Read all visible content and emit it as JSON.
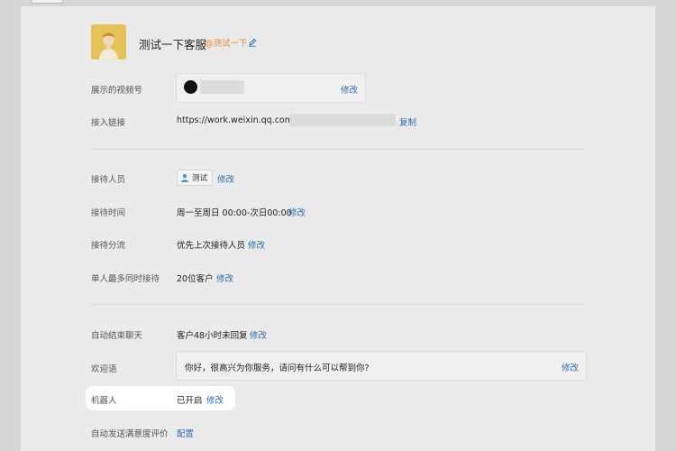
{
  "profile": {
    "name": "测试一下客服",
    "handle": "@测试一下"
  },
  "rows": {
    "channel": {
      "label": "展示的视频号",
      "edit": "修改"
    },
    "link": {
      "label": "接入链接",
      "url": "https://work.weixin.qq.com/",
      "copy": "复制"
    },
    "agents": {
      "label": "接待人员",
      "agent": "测试",
      "edit": "修改"
    },
    "hours": {
      "label": "接待时间",
      "value": "周一至周日 00:00-次日00:00",
      "edit": "修改"
    },
    "routing": {
      "label": "接待分流",
      "value": "优先上次接待人员",
      "edit": "修改"
    },
    "max_sessions": {
      "label": "单人最多同时接待",
      "value": "20位客户",
      "edit": "修改"
    },
    "auto_end": {
      "label": "自动结束聊天",
      "value": "客户48小时未回复",
      "edit": "修改"
    },
    "welcome": {
      "label": "欢迎语",
      "value": "你好，很高兴为你服务，请问有什么可以帮到你?",
      "edit": "修改"
    },
    "robot": {
      "label": "机器人",
      "value": "已开启",
      "edit": "修改"
    },
    "survey": {
      "label": "自动发送满意度评价",
      "config": "配置"
    }
  },
  "colors": {
    "link": "#2c6db5",
    "handle": "#e8863a",
    "avatar": "#e6c35a"
  }
}
